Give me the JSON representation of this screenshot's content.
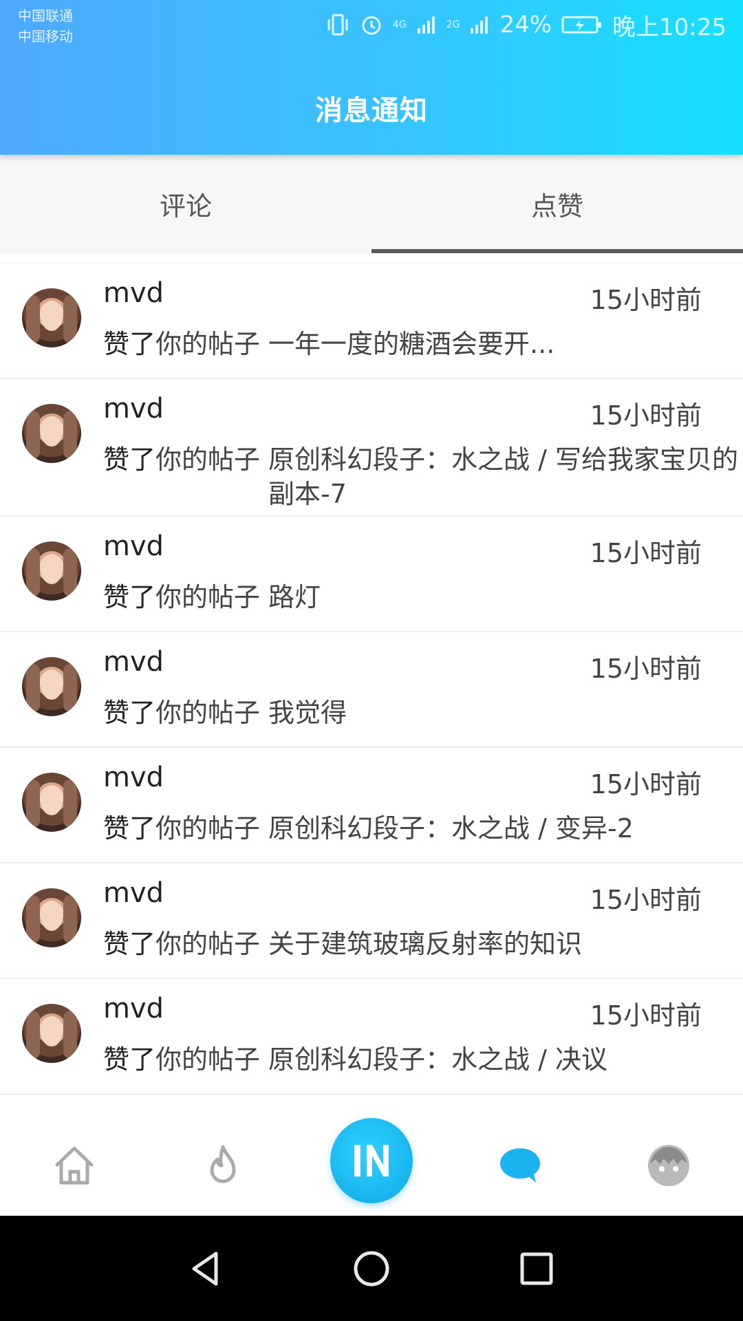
{
  "status_bar": {
    "carrier_1": "中国联通",
    "carrier_2": "中国移动",
    "network_1": "4G",
    "network_2": "2G",
    "battery": "24%",
    "time": "晚上10:25"
  },
  "header": {
    "title": "消息通知"
  },
  "tabs": [
    {
      "label": "评论",
      "active": false
    },
    {
      "label": "点赞",
      "active": true
    }
  ],
  "notifications": [
    {
      "user": "mvd",
      "time": "15小时前",
      "verb": "赞了",
      "prefix": "你的帖子",
      "post": "一年一度的糖酒会要开..."
    },
    {
      "user": "mvd",
      "time": "15小时前",
      "verb": "赞了",
      "prefix": "你的帖子",
      "post": "原创科幻段子：水之战 / 写给我家宝贝的副本-7"
    },
    {
      "user": "mvd",
      "time": "15小时前",
      "verb": "赞了",
      "prefix": "你的帖子",
      "post": "路灯"
    },
    {
      "user": "mvd",
      "time": "15小时前",
      "verb": "赞了",
      "prefix": "你的帖子",
      "post": "我觉得"
    },
    {
      "user": "mvd",
      "time": "15小时前",
      "verb": "赞了",
      "prefix": "你的帖子",
      "post": "原创科幻段子：水之战 / 变异-2"
    },
    {
      "user": "mvd",
      "time": "15小时前",
      "verb": "赞了",
      "prefix": "你的帖子",
      "post": "关于建筑玻璃反射率的知识"
    },
    {
      "user": "mvd",
      "time": "15小时前",
      "verb": "赞了",
      "prefix": "你的帖子",
      "post": "原创科幻段子：水之战 / 决议"
    }
  ],
  "bottom_nav": {
    "items": [
      {
        "icon": "home-icon"
      },
      {
        "icon": "fire-icon"
      },
      {
        "icon": "in-logo-icon",
        "label": "IN"
      },
      {
        "icon": "message-bubble-icon",
        "active": true
      },
      {
        "icon": "profile-face-icon"
      }
    ]
  },
  "colors": {
    "header_gradient_start": "#4fa9ff",
    "header_gradient_end": "#16e0ff",
    "accent": "#1ab3f0",
    "tab_indicator": "#5b5b5b"
  }
}
